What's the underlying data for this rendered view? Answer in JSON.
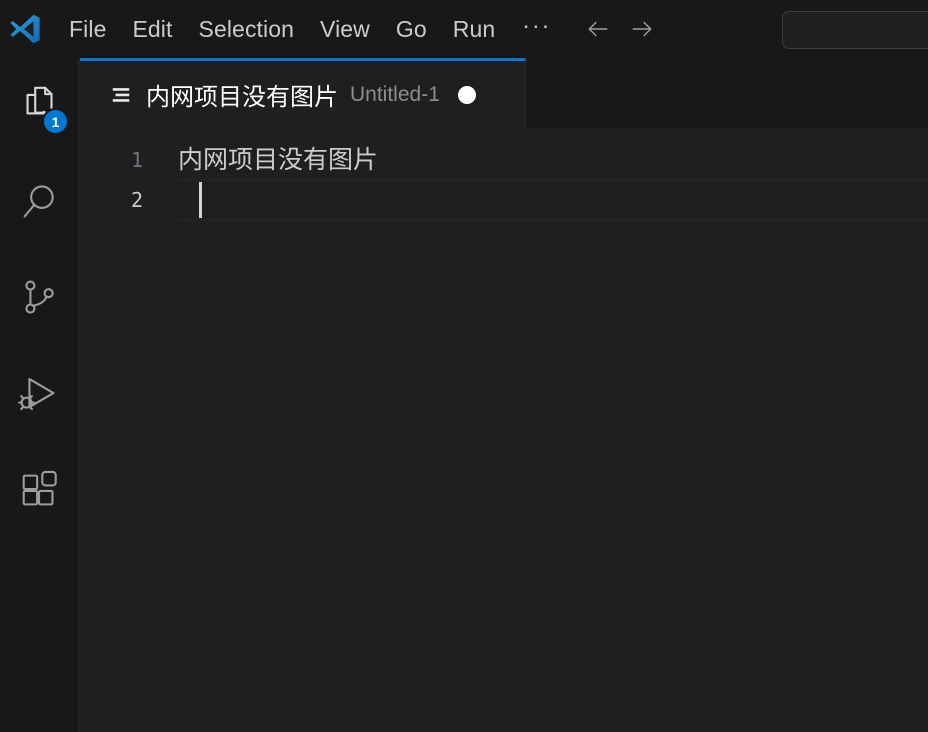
{
  "window": {
    "app_name": "Visual Studio Code",
    "background": "#1f1f1f",
    "accent": "#0078d4"
  },
  "titlebar": {
    "logo_icon": "vscode-logo-icon",
    "menus": [
      {
        "label": "File",
        "name": "menu-file"
      },
      {
        "label": "Edit",
        "name": "menu-edit"
      },
      {
        "label": "Selection",
        "name": "menu-selection"
      },
      {
        "label": "View",
        "name": "menu-view"
      },
      {
        "label": "Go",
        "name": "menu-go"
      },
      {
        "label": "Run",
        "name": "menu-run"
      }
    ],
    "more_label": "···",
    "nav_back_icon": "arrow-left-icon",
    "nav_forward_icon": "arrow-right-icon",
    "command_center": {
      "value": "",
      "placeholder": ""
    }
  },
  "activitybar": {
    "items": [
      {
        "name": "activity-bar-item-explorer",
        "icon": "files-icon",
        "badge": "1"
      },
      {
        "name": "activity-bar-item-search",
        "icon": "search-icon",
        "badge": ""
      },
      {
        "name": "activity-bar-item-source-control",
        "icon": "source-control-icon",
        "badge": ""
      },
      {
        "name": "activity-bar-item-run-debug",
        "icon": "run-and-debug-icon",
        "badge": ""
      },
      {
        "name": "activity-bar-item-extensions",
        "icon": "extensions-icon",
        "badge": ""
      }
    ]
  },
  "editor": {
    "tab": {
      "icon": "text-file-icon",
      "label": "内网项目没有图片",
      "description": "Untitled-1",
      "dirty_indicator": "unsaved-dot"
    },
    "lines": [
      {
        "number": "1",
        "text": "内网项目没有图片",
        "active": false
      },
      {
        "number": "2",
        "text": "",
        "active": true
      }
    ]
  }
}
